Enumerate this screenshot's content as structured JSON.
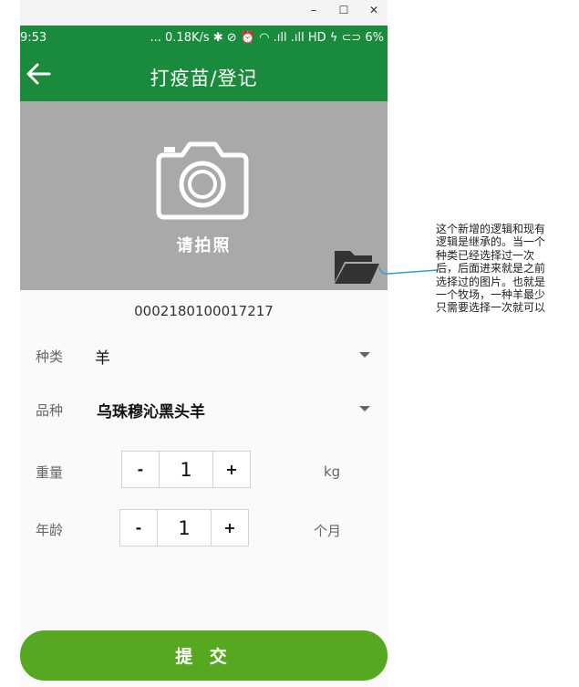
{
  "window": {
    "minimize_glyph": "–",
    "maximize_glyph": "☐",
    "close_glyph": "✕"
  },
  "status_bar": {
    "time": "9:53",
    "right": "... 0.18K/s ✱ ⊘ ⏰ ◠ .ıll .ıll HD ϟ ⊂⊃ 6%"
  },
  "app_bar": {
    "title": "打疫苗/登记",
    "back_icon": "arrow-left-icon"
  },
  "photo": {
    "label": "请拍照",
    "camera_icon": "camera-icon",
    "folder_icon": "folder-open-icon"
  },
  "tag_number": "0002180100017217",
  "form": {
    "category": {
      "label": "种类",
      "value": "羊"
    },
    "breed": {
      "label": "品种",
      "value": "乌珠穆沁黑头羊"
    },
    "weight": {
      "label": "重量",
      "minus": "-",
      "value": "1",
      "plus": "+",
      "unit": "kg"
    },
    "age": {
      "label": "年龄",
      "minus": "-",
      "value": "1",
      "plus": "+",
      "unit": "个月"
    }
  },
  "submit_label": "提 交",
  "annotation": {
    "lines": [
      "这个新增的逻辑和现有",
      "逻辑是继承的。当一个",
      "种类已经选择过一次",
      "后，后面进来就是之前",
      "选择过的图片。也就是",
      "一个牧场，一种羊最少",
      "只需要选择一次就可以"
    ]
  },
  "colors": {
    "brand_green": "#1a8a3c",
    "submit_green": "#55a820",
    "photo_gray": "#a9a9a9",
    "connector_blue": "#2a9fd0"
  }
}
